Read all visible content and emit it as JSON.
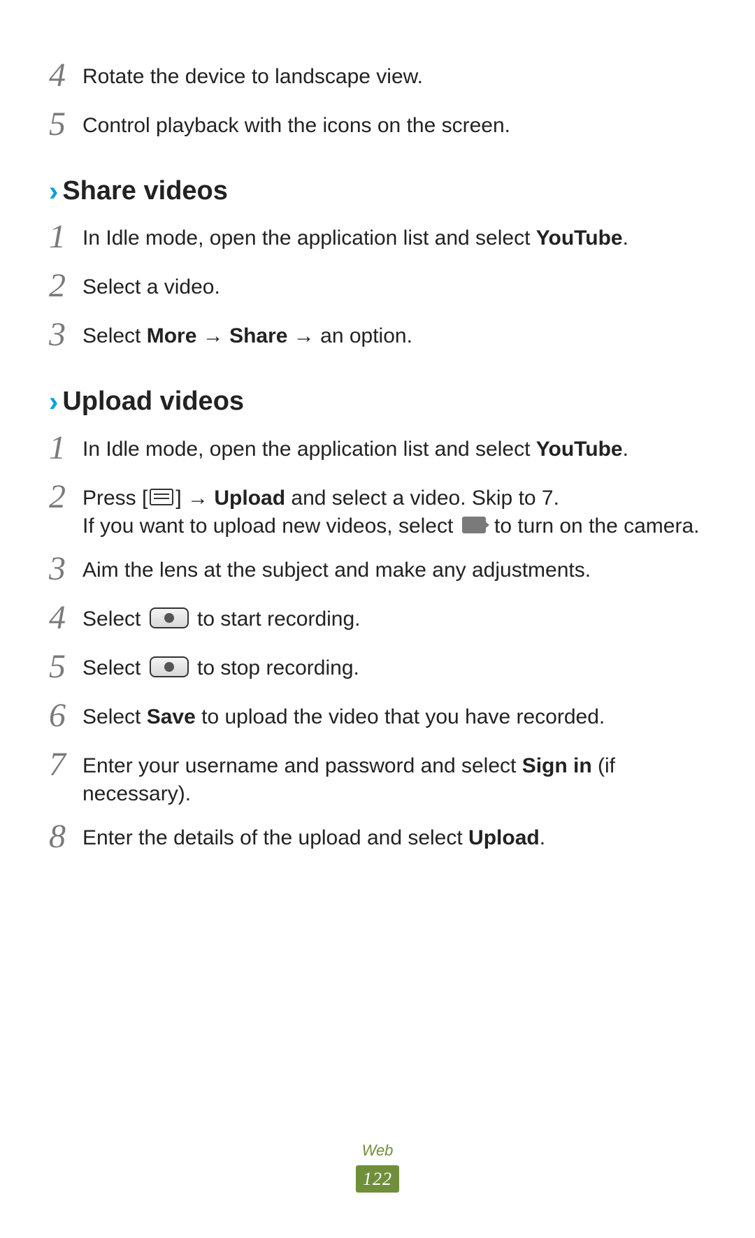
{
  "intro_steps": [
    {
      "num": "4",
      "text": "Rotate the device to landscape view."
    },
    {
      "num": "5",
      "text": "Control playback with the icons on the screen."
    }
  ],
  "sections": {
    "share": {
      "title": "Share videos",
      "steps": {
        "s1": {
          "num": "1",
          "pre": "In Idle mode, open the application list and select ",
          "bold": "YouTube",
          "post": "."
        },
        "s2": {
          "num": "2",
          "text": "Select a video."
        },
        "s3": {
          "num": "3",
          "pre": "Select ",
          "b1": "More",
          "mid1": " → ",
          "b2": "Share",
          "mid2": " → an option."
        }
      }
    },
    "upload": {
      "title": "Upload videos",
      "steps": {
        "s1": {
          "num": "1",
          "pre": "In Idle mode, open the application list and select ",
          "bold": "YouTube",
          "post": "."
        },
        "s2": {
          "num": "2",
          "l1_pre": "Press [",
          "l1_mid": "] → ",
          "l1_b": "Upload",
          "l1_post": " and select a video. Skip to 7.",
          "l2_pre": "If you want to upload new videos, select ",
          "l2_post": " to turn on the camera."
        },
        "s3": {
          "num": "3",
          "text": "Aim the lens at the subject and make any adjustments."
        },
        "s4": {
          "num": "4",
          "pre": "Select ",
          "post": " to start recording."
        },
        "s5": {
          "num": "5",
          "pre": "Select ",
          "post": " to stop recording."
        },
        "s6": {
          "num": "6",
          "pre": "Select ",
          "bold": "Save",
          "post": " to upload the video that you have recorded."
        },
        "s7": {
          "num": "7",
          "pre": "Enter your username and password and select ",
          "bold": "Sign in",
          "post": " (if necessary)."
        },
        "s8": {
          "num": "8",
          "pre": "Enter the details of the upload and select ",
          "bold": "Upload",
          "post": "."
        }
      }
    }
  },
  "footer": {
    "section": "Web",
    "page": "122"
  }
}
